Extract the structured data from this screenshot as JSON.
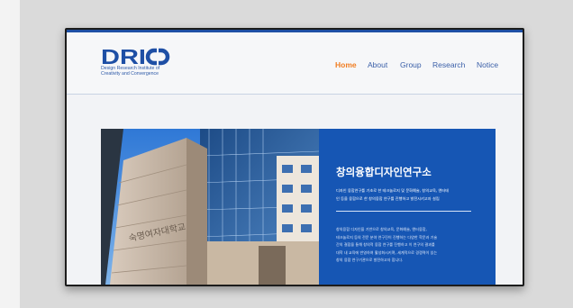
{
  "brand": {
    "logo": "DRICO",
    "name_line1": "Design Research Institute of",
    "name_line2": "Creativity and Convergence"
  },
  "nav": [
    "Home",
    "About",
    "Group",
    "Research",
    "Notice"
  ],
  "nav_active": "Home",
  "sign_text": "숙명여자대학교",
  "panel": {
    "title": "창의융합디자인연구소",
    "subtitle_lines": [
      "디자인 융합연구를 기초로 한 테크놀로지 및 문화예술, 창의교육, 엔터테",
      "인 등을 융합으로 한 창의융합 연구를 진행하고 발전시키고자 설립"
    ],
    "body_lines": [
      "창의융합 디자인을 기반으로 창의교육, 문화예술, 엔터융합,",
      "테크놀로지 등의 전문 분야 연구진이 진행하는 다양한 학문과 기술",
      "간의 결합을 통해 창의적 융합 연구를 진행하고 이 연구의 결과를",
      "대학 내 교육에 반영하여 활성화시키며, 세계적으로 경쟁력이 있는",
      "창의 융합 연구기관으로 발전하고자 합니다."
    ]
  },
  "colors": {
    "brand_blue": "#1e4fa5",
    "nav_active": "#f07d22",
    "nav": "#3a5fa8",
    "panel_bg": "#1656b4"
  }
}
